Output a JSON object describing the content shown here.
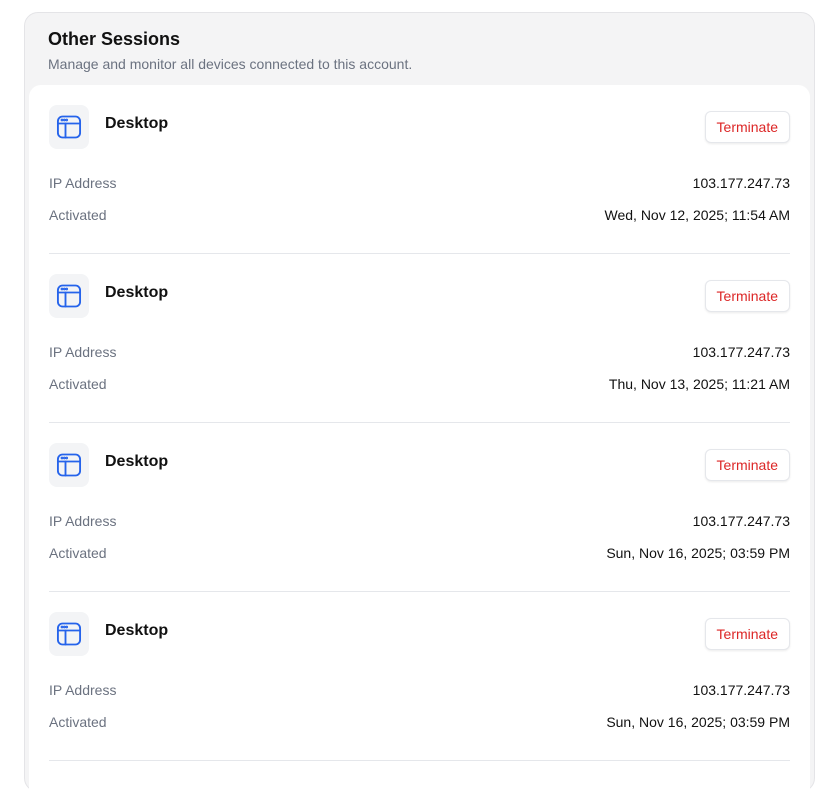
{
  "header": {
    "title": "Other Sessions",
    "subtitle": "Manage and monitor all devices connected to this account."
  },
  "colors": {
    "terminate": "#dc2626",
    "icon": "#2563eb"
  },
  "sessions": [
    {
      "icon": "browser-window-icon",
      "device": "Desktop",
      "terminate_label": "Terminate",
      "ip_label": "IP Address",
      "ip": "103.177.247.73",
      "activated_label": "Activated",
      "activated": "Wed, Nov 12, 2025; 11:54 AM"
    },
    {
      "icon": "browser-window-icon",
      "device": "Desktop",
      "terminate_label": "Terminate",
      "ip_label": "IP Address",
      "ip": "103.177.247.73",
      "activated_label": "Activated",
      "activated": "Thu, Nov 13, 2025; 11:21 AM"
    },
    {
      "icon": "browser-window-icon",
      "device": "Desktop",
      "terminate_label": "Terminate",
      "ip_label": "IP Address",
      "ip": "103.177.247.73",
      "activated_label": "Activated",
      "activated": "Sun, Nov 16, 2025; 03:59 PM"
    },
    {
      "icon": "browser-window-icon",
      "device": "Desktop",
      "terminate_label": "Terminate",
      "ip_label": "IP Address",
      "ip": "103.177.247.73",
      "activated_label": "Activated",
      "activated": "Sun, Nov 16, 2025; 03:59 PM"
    }
  ]
}
